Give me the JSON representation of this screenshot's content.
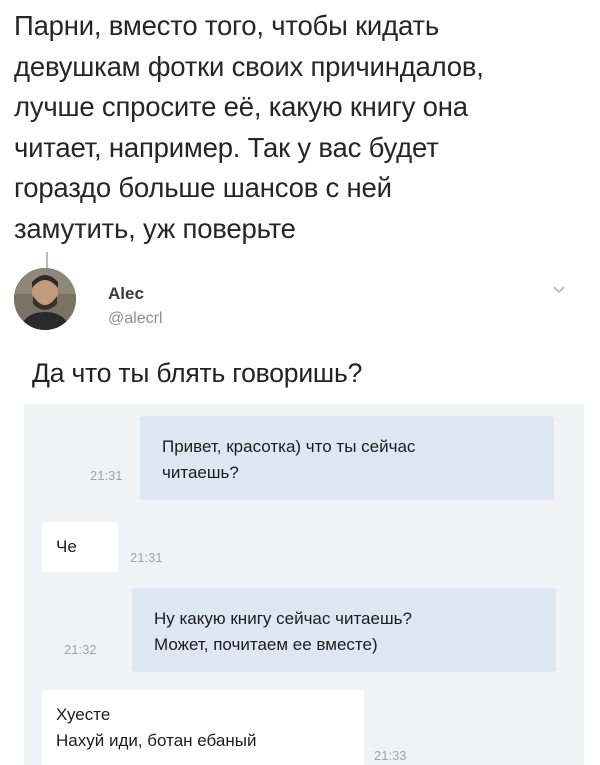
{
  "post": {
    "lines": [
      "Парни, вместо того, чтобы кидать",
      "девушкам фотки своих причиндалов,",
      "лучше спросите её, какую книгу она",
      "читает, например. Так у вас будет",
      "гораздо больше шансов с ней",
      "замутить, уж поверьте"
    ]
  },
  "reply": {
    "author_name": "Alec",
    "author_handle": "@alecrl",
    "text": "Да что ты блять говоришь?"
  },
  "chat": {
    "messages": [
      {
        "direction": "outgoing",
        "lines": [
          "Привет, красотка) что ты сейчас",
          "читаешь?"
        ],
        "time": "21:31"
      },
      {
        "direction": "incoming",
        "lines": [
          "Че"
        ],
        "time": "21:31"
      },
      {
        "direction": "outgoing",
        "lines": [
          "Ну какую книгу сейчас читаешь?",
          "Может, почитаем ее вместе)"
        ],
        "time": "21:32"
      },
      {
        "direction": "incoming",
        "lines": [
          "Хуесте",
          "Нахуй иди, ботан ебаный"
        ],
        "time": "21:33"
      }
    ]
  },
  "icons": {
    "chevron": "chevron-down-icon",
    "avatar": "profile-photo"
  },
  "colors": {
    "outgoing_bubble": "#dde6f3",
    "incoming_bubble": "#ffffff",
    "chat_background": "#f1f2f5",
    "timestamp": "#a1a5ab"
  }
}
